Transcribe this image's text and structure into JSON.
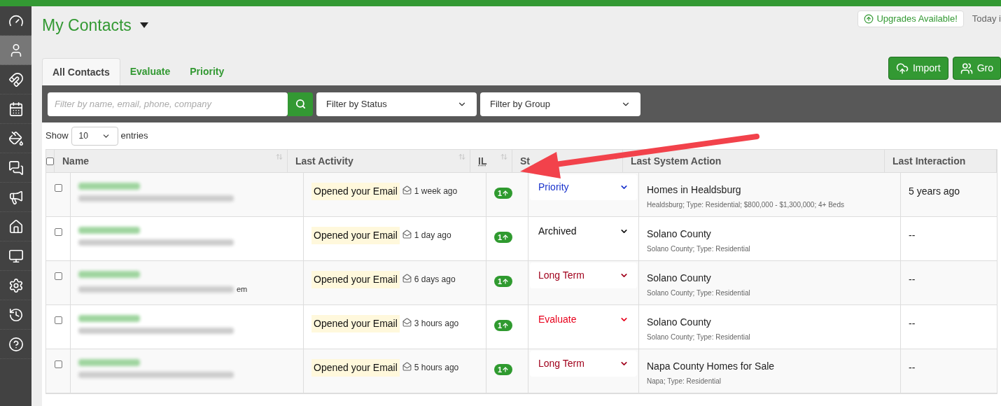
{
  "sidebar": {
    "items": [
      {
        "selected": false
      },
      {
        "selected": true
      },
      {
        "selected": false
      },
      {
        "selected": false
      },
      {
        "selected": false
      },
      {
        "selected": false
      },
      {
        "selected": false
      },
      {
        "selected": false
      },
      {
        "selected": false
      },
      {
        "selected": false
      },
      {
        "selected": false
      },
      {
        "selected": false
      }
    ]
  },
  "header": {
    "title": "My Contacts",
    "upgrades": "Upgrades Available!",
    "today": "Today i"
  },
  "tabs": [
    {
      "label": "All Contacts",
      "selected": true
    },
    {
      "label": "Evaluate",
      "selected": false
    },
    {
      "label": "Priority",
      "selected": false
    }
  ],
  "buttons": [
    "Import",
    "Gro"
  ],
  "filters": {
    "search_placeholder": "Filter by name, email, phone, company",
    "status": "Filter by Status",
    "group": "Filter by Group"
  },
  "length": {
    "show": "Show",
    "value": "10",
    "entries": "entries"
  },
  "table": {
    "select_all_checked": false,
    "columns": [
      "Name",
      "Last Activity",
      "IL",
      "St",
      "Last System Action",
      "Last Interaction"
    ],
    "rows": [
      {
        "checked": false,
        "activity": "Opened your Email",
        "time": "1 week ago",
        "il": "1",
        "status": "Priority",
        "color": "#1a33cc",
        "action": "Homes in Healdsburg",
        "action_detail": "Healdsburg; Type: Residential; $800,000 - $1,300,000; 4+ Beds",
        "interaction": "5 years ago"
      },
      {
        "checked": false,
        "activity": "Opened your Email",
        "time": "1 day ago",
        "il": "1",
        "status": "Archived",
        "color": "#111111",
        "action": "Solano County",
        "action_detail": "Solano County; Type: Residential",
        "interaction": "--"
      },
      {
        "checked": false,
        "activity": "Opened your Email",
        "time": "6 days ago",
        "il": "1",
        "status": "Long Term",
        "color": "#a0001b",
        "action": "Solano County",
        "action_detail": "Solano County; Type: Residential",
        "interaction": "--",
        "name_fragment": "em"
      },
      {
        "checked": false,
        "activity": "Opened your Email",
        "time": "3 hours ago",
        "il": "1",
        "status": "Evaluate",
        "color": "#e8001c",
        "action": "Solano County",
        "action_detail": "Solano County; Type: Residential",
        "interaction": "--"
      },
      {
        "checked": false,
        "activity": "Opened your Email",
        "time": "5 hours ago",
        "il": "1",
        "status": "Long Term",
        "color": "#a0001b",
        "action": "Napa County Homes for Sale",
        "action_detail": "Napa; Type: Residential",
        "interaction": "--"
      }
    ]
  }
}
